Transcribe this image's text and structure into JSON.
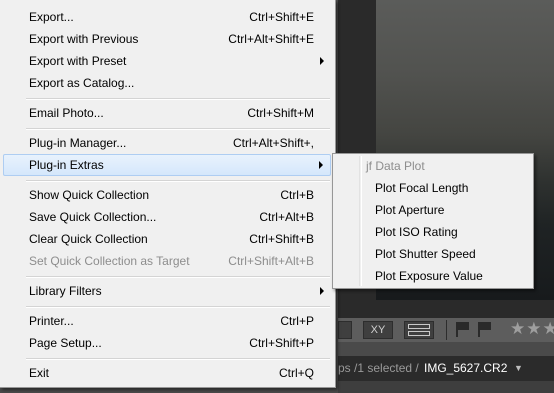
{
  "background": {
    "toolbar": {
      "xy_label": "XY",
      "stars": "★★★"
    },
    "status": {
      "path_text": "ps /1 selected /",
      "filename": "IMG_5627.CR2",
      "caret": "▼"
    }
  },
  "file_menu": {
    "items": [
      {
        "label": "Export...",
        "accel": "Ctrl+Shift+E"
      },
      {
        "label": "Export with Previous",
        "accel": "Ctrl+Alt+Shift+E"
      },
      {
        "label": "Export with Preset",
        "accel": "",
        "submenu": true
      },
      {
        "label": "Export as Catalog...",
        "accel": ""
      },
      {
        "label": "Email Photo...",
        "accel": "Ctrl+Shift+M"
      },
      {
        "label": "Plug-in Manager...",
        "accel": "Ctrl+Alt+Shift+,"
      },
      {
        "label": "Plug-in Extras",
        "accel": "",
        "submenu": true,
        "highlighted": true
      },
      {
        "label": "Show Quick Collection",
        "accel": "Ctrl+B"
      },
      {
        "label": "Save Quick Collection...",
        "accel": "Ctrl+Alt+B"
      },
      {
        "label": "Clear Quick Collection",
        "accel": "Ctrl+Shift+B"
      },
      {
        "label": "Set Quick Collection as Target",
        "accel": "Ctrl+Shift+Alt+B",
        "disabled": true
      },
      {
        "label": "Library Filters",
        "accel": "",
        "submenu": true
      },
      {
        "label": "Printer...",
        "accel": "Ctrl+P"
      },
      {
        "label": "Page Setup...",
        "accel": "Ctrl+Shift+P"
      },
      {
        "label": "Exit",
        "accel": "Ctrl+Q"
      }
    ]
  },
  "plugin_extras_submenu": {
    "header": "jf Data Plot",
    "items": [
      {
        "label": "Plot Focal Length"
      },
      {
        "label": "Plot Aperture"
      },
      {
        "label": "Plot ISO Rating"
      },
      {
        "label": "Plot Shutter Speed"
      },
      {
        "label": "Plot Exposure Value"
      }
    ]
  }
}
